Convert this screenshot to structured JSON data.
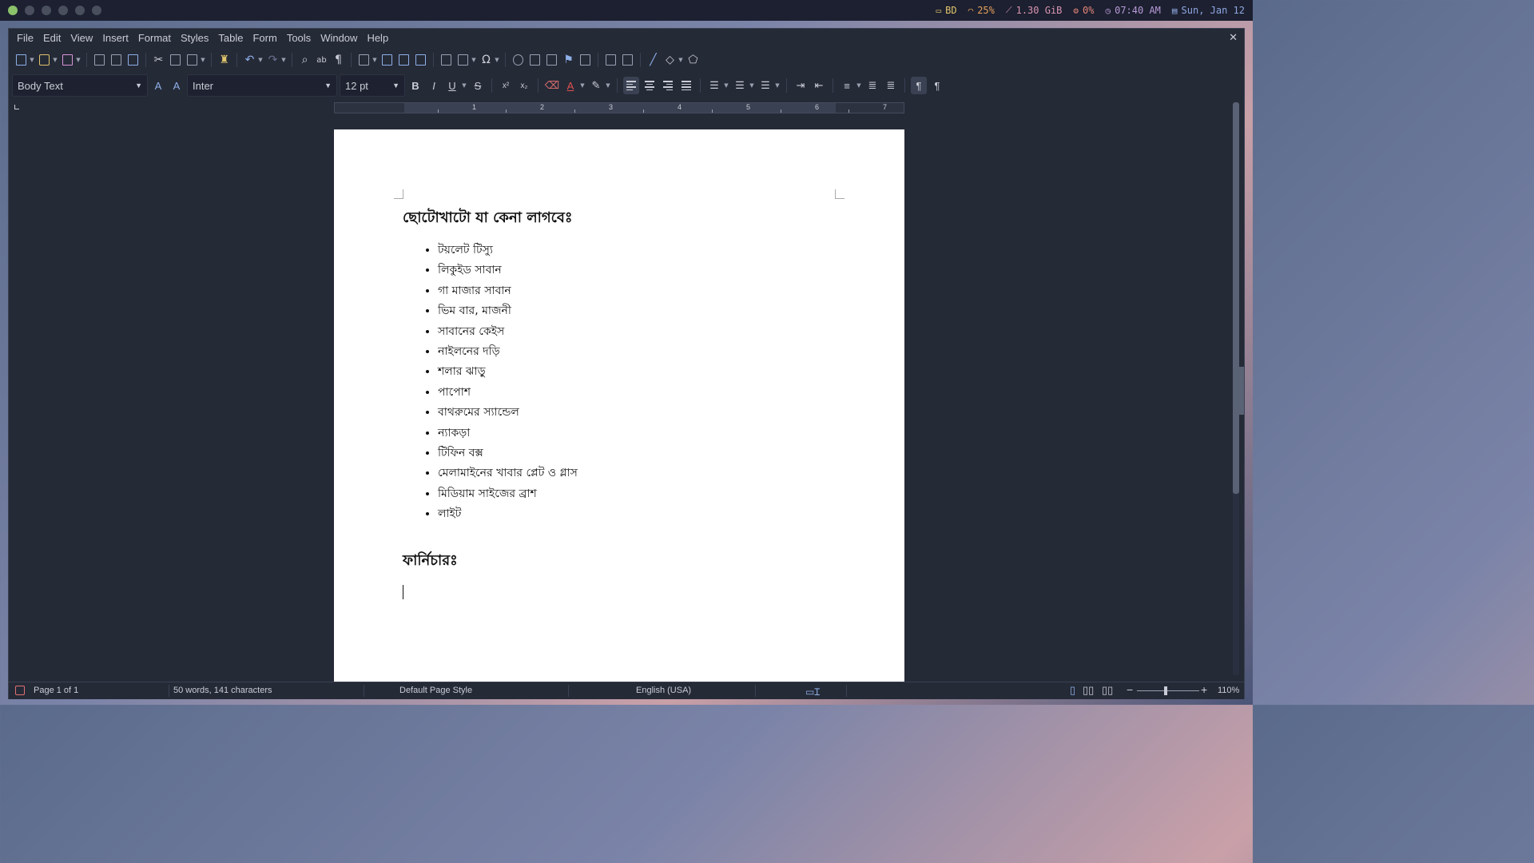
{
  "system_bar": {
    "workspaces": 6,
    "active_workspace": 1,
    "layout": "BD",
    "volume": "25%",
    "memory": "1.30 GiB",
    "cpu": "0%",
    "time": "07:40 AM",
    "date": "Sun, Jan 12"
  },
  "menubar": {
    "items": [
      "File",
      "Edit",
      "View",
      "Insert",
      "Format",
      "Styles",
      "Table",
      "Form",
      "Tools",
      "Window",
      "Help"
    ],
    "close": "✕"
  },
  "formatting": {
    "paragraph_style": "Body Text",
    "font_name": "Inter",
    "font_size": "12 pt",
    "bold": "B",
    "italic": "I",
    "underline": "U",
    "strike": "S",
    "superscript": "x²",
    "subscript": "x₂",
    "font_color_letter": "A",
    "pilcrow": "¶"
  },
  "ruler": {
    "numbers": [
      "1",
      "2",
      "3",
      "4",
      "5",
      "6",
      "7"
    ]
  },
  "document": {
    "heading1": "ছোটোখাটো যা কেনা লাগবেঃ",
    "items": [
      "টয়লেট টিস্যু",
      "লিকুইড সাবান",
      "গা মাজার সাবান",
      "ভিম বার, মাজনী",
      "সাবানের কেইস",
      "নাইলনের দড়ি",
      "শলার ঝাড়ু",
      "পাপোশ",
      "বাথরুমের স্যান্ডেল",
      "ন্যাকড়া",
      "টিফিন বক্স",
      "মেলামাইনের খাবার প্লেট ও গ্লাস",
      "মিডিয়াম সাইজের ব্রাশ",
      "লাইট"
    ],
    "heading2": "ফার্নিচারঃ"
  },
  "statusbar": {
    "page": "Page 1 of 1",
    "word_count": "50 words, 141 characters",
    "page_style": "Default Page Style",
    "language": "English (USA)",
    "zoom": "110%",
    "zoom_minus": "−",
    "zoom_plus": "+"
  }
}
